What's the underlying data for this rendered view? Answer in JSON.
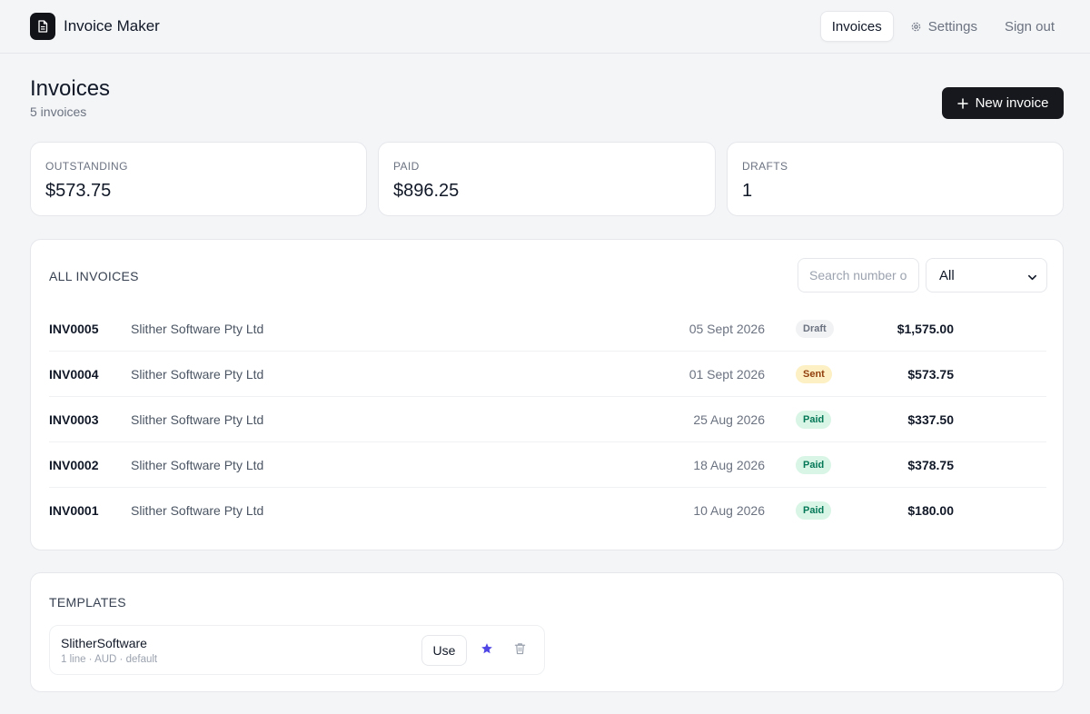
{
  "app": {
    "name": "Invoice Maker"
  },
  "nav": [
    {
      "label": "Invoices",
      "active": true
    },
    {
      "label": "Settings",
      "icon": "gear-icon"
    },
    {
      "label": "Sign out"
    }
  ],
  "page": {
    "title": "Invoices",
    "subtitle": "5 invoices",
    "new_button": "New invoice"
  },
  "stats": [
    {
      "label": "OUTSTANDING",
      "value": "$573.75"
    },
    {
      "label": "PAID",
      "value": "$896.25"
    },
    {
      "label": "DRAFTS",
      "value": "1"
    }
  ],
  "invoices_panel": {
    "title": "ALL INVOICES",
    "search_placeholder": "Search number o",
    "filter_value": "All",
    "rows": [
      {
        "number": "INV0005",
        "client": "Slither Software Pty Ltd",
        "date": "05 Sept 2026",
        "status": "Draft",
        "amount": "$1,575.00"
      },
      {
        "number": "INV0004",
        "client": "Slither Software Pty Ltd",
        "date": "01 Sept 2026",
        "status": "Sent",
        "amount": "$573.75"
      },
      {
        "number": "INV0003",
        "client": "Slither Software Pty Ltd",
        "date": "25 Aug 2026",
        "status": "Paid",
        "amount": "$337.50"
      },
      {
        "number": "INV0002",
        "client": "Slither Software Pty Ltd",
        "date": "18 Aug 2026",
        "status": "Paid",
        "amount": "$378.75"
      },
      {
        "number": "INV0001",
        "client": "Slither Software Pty Ltd",
        "date": "10 Aug 2026",
        "status": "Paid",
        "amount": "$180.00"
      }
    ]
  },
  "templates_panel": {
    "title": "TEMPLATES",
    "items": [
      {
        "name": "SlitherSoftware",
        "meta": "1 line · AUD · default",
        "use_label": "Use"
      }
    ]
  },
  "colors": {
    "accent": "#16181d",
    "star": "#4f46e5",
    "draft_bg": "#f1f2f4",
    "draft_fg": "#6b7280",
    "sent_bg": "#fdf0c4",
    "sent_fg": "#92400e",
    "paid_bg": "#d9f5e6",
    "paid_fg": "#047857"
  }
}
